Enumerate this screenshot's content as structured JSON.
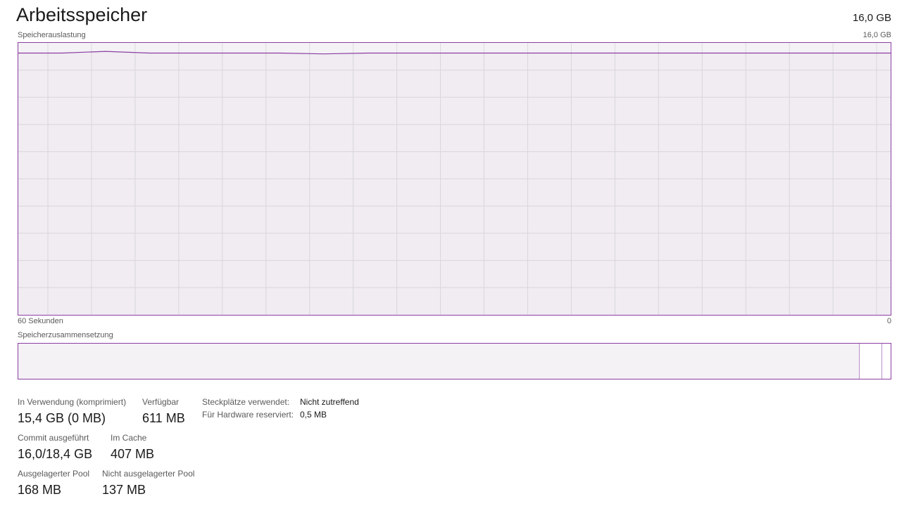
{
  "header": {
    "title": "Arbeitsspeicher",
    "capacity": "16,0 GB"
  },
  "usage_graph": {
    "label": "Speicherauslastung",
    "max_label": "16,0 GB",
    "time_left_label": "60 Sekunden",
    "time_right_label": "0",
    "line_color": "#8b3fa3",
    "fill_color": "#f4f2f5",
    "grid_color": "#dcdcdc",
    "usage_series_gb": [
      15.4,
      15.4,
      15.5,
      15.4,
      15.4,
      15.4,
      15.4,
      15.35,
      15.4,
      15.4,
      15.4,
      15.4,
      15.4,
      15.4,
      15.4,
      15.4,
      15.4,
      15.4,
      15.4,
      15.4,
      15.4
    ],
    "max_gb": 16.0
  },
  "composition": {
    "label": "Speicherzusammensetzung",
    "in_use_fraction": 0.964,
    "modified_fraction": 0.0,
    "standby_fraction": 0.025,
    "free_fraction": 0.011
  },
  "stats": {
    "in_use": {
      "label": "In Verwendung (komprimiert)",
      "value": "15,4 GB (0 MB)"
    },
    "available": {
      "label": "Verfügbar",
      "value": "611 MB"
    },
    "committed": {
      "label": "Commit ausgeführt",
      "value": "16,0/18,4 GB"
    },
    "cached": {
      "label": "Im Cache",
      "value": "407 MB"
    },
    "paged_pool": {
      "label": "Ausgelagerter Pool",
      "value": "168 MB"
    },
    "nonpaged_pool": {
      "label": "Nicht ausgelagerter Pool",
      "value": "137 MB"
    }
  },
  "details": {
    "slots": {
      "label": "Steckplätze verwendet:",
      "value": "Nicht zutreffend"
    },
    "hw_reserved": {
      "label": "Für Hardware reserviert:",
      "value": "0,5 MB"
    }
  }
}
